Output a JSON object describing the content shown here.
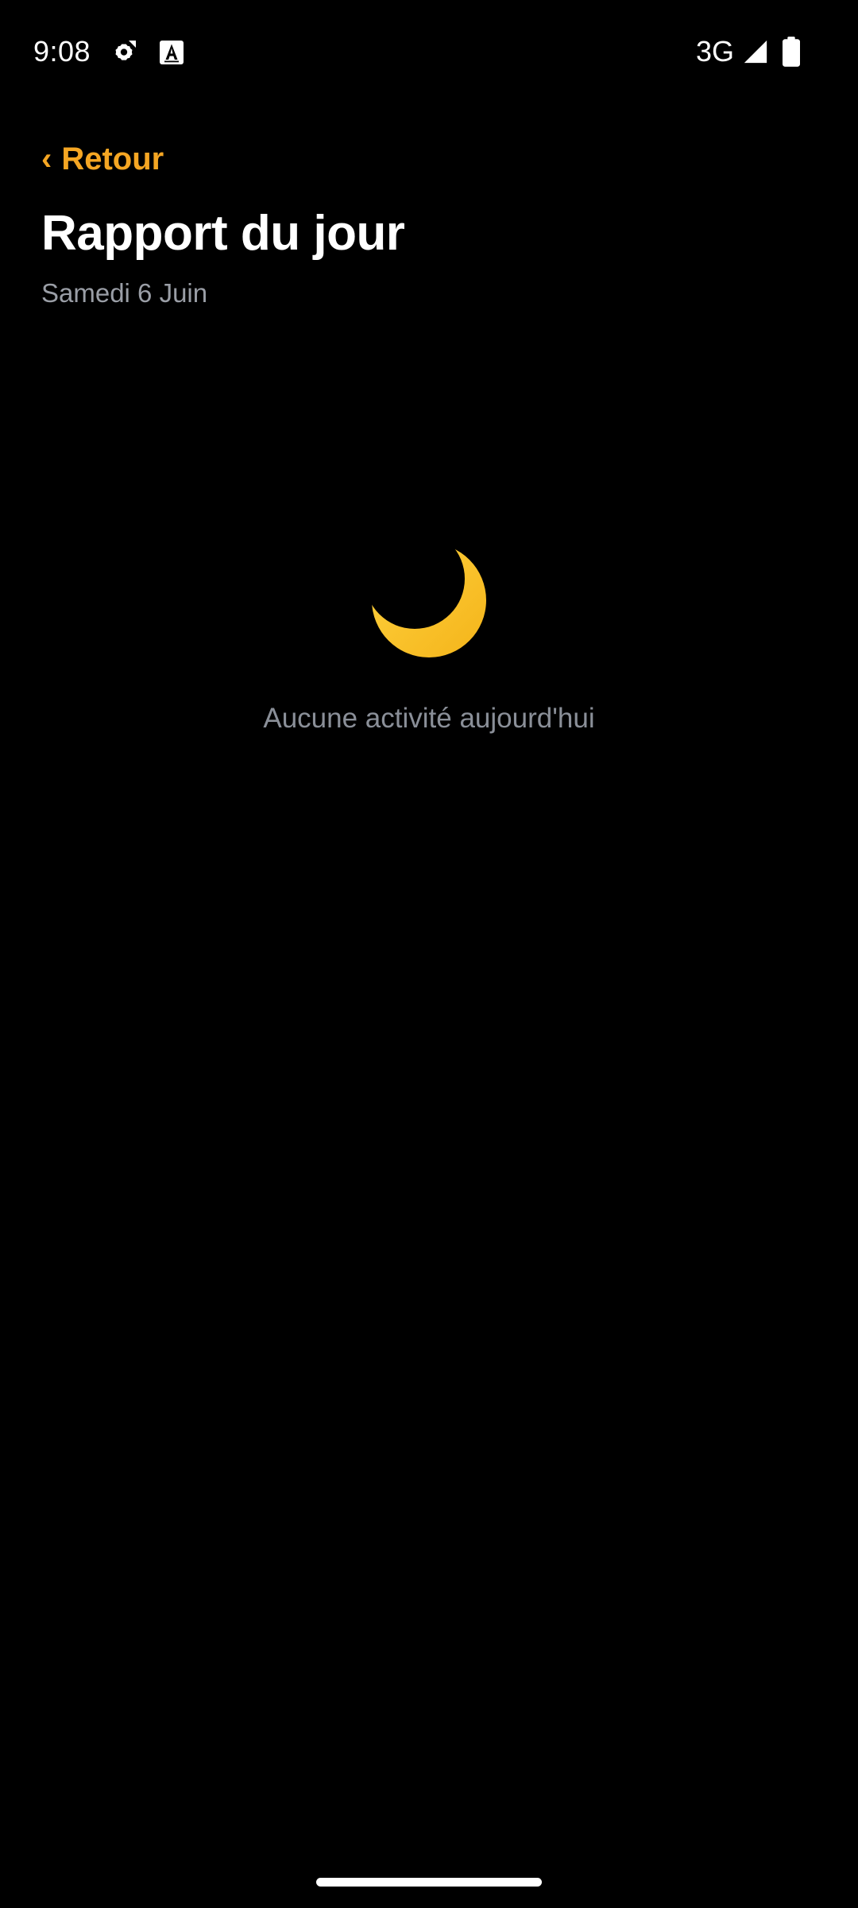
{
  "status_bar": {
    "time": "9:08",
    "network": "3G",
    "icons": [
      "settings-icon",
      "text-icon",
      "signal-icon",
      "battery-icon"
    ]
  },
  "header": {
    "back_label": "Retour",
    "back_chevron": "‹",
    "title": "Rapport du jour",
    "date": "Samedi 6 Juin"
  },
  "empty_state": {
    "icon": "crescent-moon-icon",
    "message": "Aucune activité aujourd'hui"
  },
  "colors": {
    "accent": "#f5a623",
    "background": "#000000",
    "muted_text": "#8a8f98",
    "moon": "#fbc531"
  }
}
